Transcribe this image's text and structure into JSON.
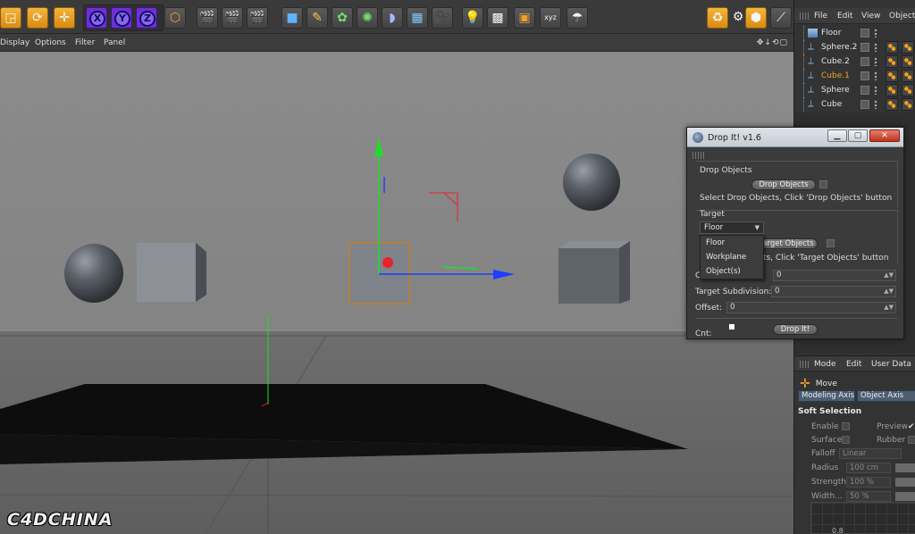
{
  "toolbar": {
    "axis_x": "X",
    "axis_y": "Y",
    "axis_z": "Z"
  },
  "viewport_menu": {
    "display": "Display",
    "options": "Options",
    "filter": "Filter",
    "panel": "Panel"
  },
  "watermark": "C4DCHINA",
  "object_manager": {
    "menu": {
      "file": "File",
      "edit": "Edit",
      "view": "View",
      "objects": "Objects"
    },
    "objects": [
      {
        "name": "Floor",
        "selected": false
      },
      {
        "name": "Sphere.2",
        "selected": false
      },
      {
        "name": "Cube.2",
        "selected": false
      },
      {
        "name": "Cube.1",
        "selected": true
      },
      {
        "name": "Sphere",
        "selected": false
      },
      {
        "name": "Cube",
        "selected": false
      }
    ]
  },
  "attribute_manager": {
    "menu": {
      "mode": "Mode",
      "edit": "Edit",
      "user_data": "User Data"
    },
    "tool_name": "Move",
    "tabs": {
      "modeling_axis": "Modeling Axis",
      "object_axis": "Object Axis"
    },
    "section": "Soft Selection",
    "enable_label": "Enable",
    "preview_label": "Preview",
    "surface_label": "Surface",
    "rubber_label": "Rubber",
    "falloff_label": "Falloff",
    "falloff_value": "Linear",
    "radius_label": "Radius",
    "radius_value": "100 cm",
    "strength_label": "Strength",
    "strength_value": "100 %",
    "width_label": "Width...",
    "width_value": "50 %",
    "graph_tick": "0.8"
  },
  "dialog": {
    "title": "Drop It! v1.6",
    "drop_objects_heading": "Drop Objects",
    "drop_objects_button": "Drop Objects",
    "drop_objects_hint": "Select Drop Objects, Click 'Drop Objects' button",
    "target_heading": "Target",
    "target_select_value": "Floor",
    "target_options": [
      "Floor",
      "Workplane",
      "Object(s)"
    ],
    "target_objects_button": "arget Objects",
    "target_objects_hint": "cts, Click 'Target Objects' button",
    "row_c_label": "C",
    "row_c_value": "0",
    "target_subdivision_label": "Target Subdivision:",
    "target_subdivision_value": "0",
    "offset_label": "Offset:",
    "offset_value": "0",
    "cnt_label": "Cnt:",
    "drop_it_button": "Drop It!"
  },
  "colors": {
    "selected_object": "#f5a623",
    "axis_y": "#1fdc2a",
    "axis_x": "#1f3dff",
    "axis_z": "#e8232a",
    "selection_outline": "#e07b00"
  }
}
